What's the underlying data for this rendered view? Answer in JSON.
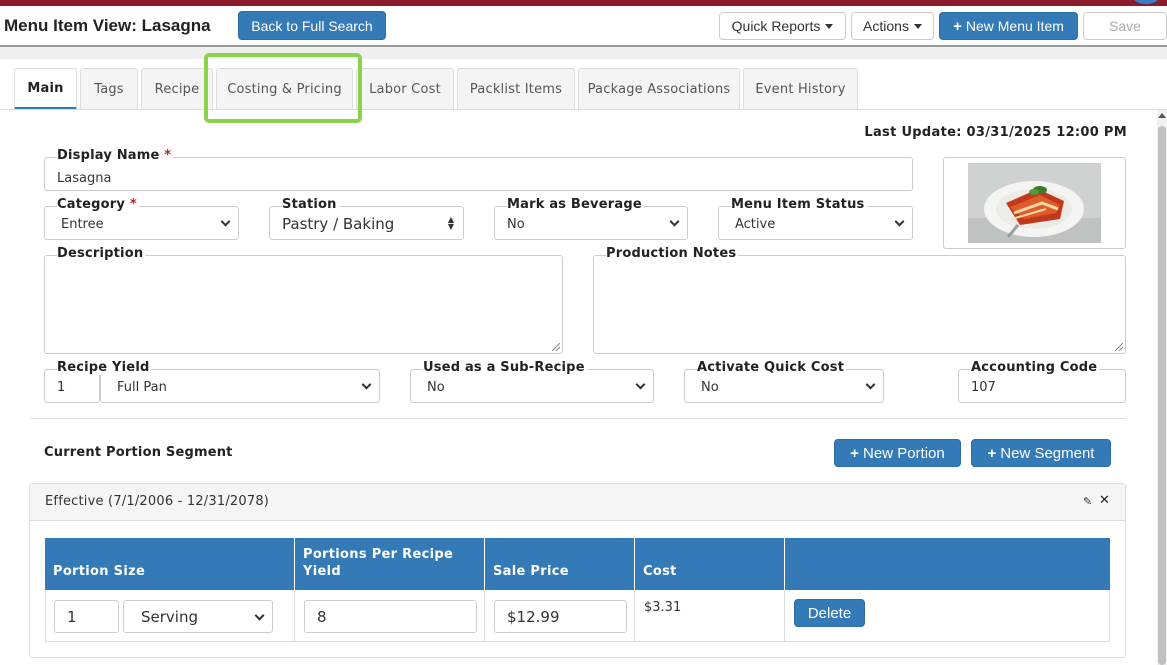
{
  "header": {
    "title": "Menu Item View: Lasagna",
    "back_button": "Back to Full Search",
    "quick_reports": "Quick Reports",
    "actions": "Actions",
    "new_menu_item": "New Menu Item",
    "save": "Save"
  },
  "tabs": [
    {
      "label": "Main",
      "active": true
    },
    {
      "label": "Tags"
    },
    {
      "label": "Recipe"
    },
    {
      "label": "Costing & Pricing",
      "highlighted": true
    },
    {
      "label": "Labor Cost"
    },
    {
      "label": "Packlist Items"
    },
    {
      "label": "Package Associations"
    },
    {
      "label": "Event History"
    }
  ],
  "last_update": "Last Update: 03/31/2025 12:00 PM",
  "form": {
    "display_name": {
      "label": "Display Name",
      "required": "*",
      "value": "Lasagna"
    },
    "category": {
      "label": "Category",
      "required": "*",
      "value": "Entree"
    },
    "station": {
      "label": "Station",
      "value": "Pastry / Baking"
    },
    "mark_as_beverage": {
      "label": "Mark as Beverage",
      "value": "No"
    },
    "menu_item_status": {
      "label": "Menu Item Status",
      "value": "Active"
    },
    "description": {
      "label": "Description",
      "value": ""
    },
    "production_notes": {
      "label": "Production Notes",
      "value": ""
    },
    "recipe_yield": {
      "label": "Recipe Yield",
      "quantity": "1",
      "unit": "Full Pan"
    },
    "used_as_sub_recipe": {
      "label": "Used as a Sub-Recipe",
      "value": "No"
    },
    "activate_quick_cost": {
      "label": "Activate Quick Cost",
      "value": "No"
    },
    "accounting_code": {
      "label": "Accounting Code",
      "value": "107"
    }
  },
  "portion_section": {
    "title": "Current Portion Segment",
    "new_portion": "New Portion",
    "new_segment": "New Segment",
    "segment_title": "Effective (7/1/2006 - 12/31/2078)",
    "columns": [
      "Portion Size",
      "Portions Per Recipe Yield",
      "Sale Price",
      "Cost",
      ""
    ],
    "row": {
      "portion_qty": "1",
      "portion_unit": "Serving",
      "portions_per_yield": "8",
      "sale_price": "$12.99",
      "cost": "$3.31",
      "delete": "Delete"
    }
  },
  "colors": {
    "primary": "#337ab7",
    "top_bar": "#8b1a2b",
    "highlight": "#8fd14f",
    "required": "#b22222"
  }
}
